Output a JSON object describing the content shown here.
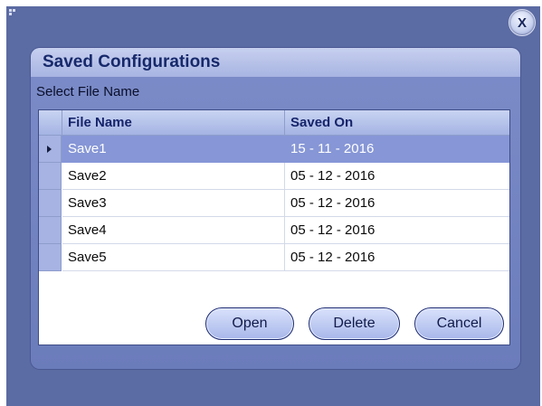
{
  "window": {
    "close_label": "X"
  },
  "dialog": {
    "title": "Saved Configurations",
    "subtitle": "Select File Name"
  },
  "table": {
    "columns": [
      "File Name",
      "Saved On"
    ],
    "selected_row": 0,
    "rows": [
      {
        "file": "Save1",
        "date": "15 - 11 - 2016"
      },
      {
        "file": "Save2",
        "date": "05 - 12 - 2016"
      },
      {
        "file": "Save3",
        "date": "05 - 12 - 2016"
      },
      {
        "file": "Save4",
        "date": "05 - 12 - 2016"
      },
      {
        "file": "Save5",
        "date": "05 - 12 - 2016"
      }
    ]
  },
  "buttons": {
    "open": "Open",
    "delete": "Delete",
    "cancel": "Cancel"
  },
  "colors": {
    "background": "#5b6ba3",
    "selection": "#8696d6",
    "title_text": "#17296b"
  }
}
